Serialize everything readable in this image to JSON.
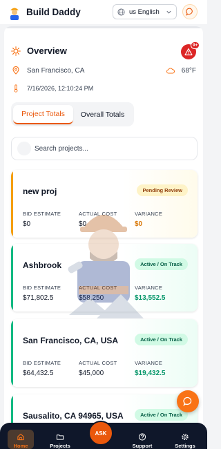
{
  "header": {
    "app_title": "Build Daddy",
    "language": "us English",
    "icons": {
      "logo": "builder-logo-icon",
      "globe": "globe-icon",
      "chevron": "chevron-down-icon",
      "chat": "chat-bubble-icon"
    }
  },
  "overview": {
    "title": "Overview",
    "alert_count": "9+",
    "location": "San Francisco, CA",
    "temperature": "68°F",
    "datetime": "7/16/2026, 12:10:24 PM"
  },
  "tabs": [
    {
      "label": "Project Totals",
      "active": true
    },
    {
      "label": "Overall Totals",
      "active": false
    }
  ],
  "search": {
    "placeholder": "Search projects..."
  },
  "labels": {
    "bid": "BID ESTIMATE",
    "actual": "ACTUAL COST",
    "variance": "VARIANCE"
  },
  "projects": [
    {
      "name": "new proj",
      "status": "Pending Review",
      "bid": "$0",
      "actual": "$0",
      "variance": "$0",
      "accent": "#f59e0b",
      "status_bg": "#fef3c7",
      "status_color": "#92400e",
      "variance_color": "#d97706"
    },
    {
      "name": "Ashbrook",
      "status": "Active / On Track",
      "bid": "$71,802.5",
      "actual": "$58,250",
      "variance": "$13,552.5",
      "accent": "#10b981",
      "status_bg": "#d1fae5",
      "status_color": "#065f46",
      "variance_color": "#059669"
    },
    {
      "name": "San Francisco, CA, USA",
      "status": "Active / On Track",
      "bid": "$64,432.5",
      "actual": "$45,000",
      "variance": "$19,432.5",
      "accent": "#10b981",
      "status_bg": "#d1fae5",
      "status_color": "#065f46",
      "variance_color": "#059669"
    },
    {
      "name": "Sausalito, CA 94965, USA",
      "status": "Active / On Track",
      "bid": "",
      "actual": "",
      "variance": "",
      "accent": "#10b981",
      "status_bg": "#d1fae5",
      "status_color": "#065f46",
      "variance_color": "#059669"
    }
  ],
  "nav": [
    {
      "label": "Home",
      "icon": "home-icon",
      "active": true
    },
    {
      "label": "Projects",
      "icon": "folder-icon",
      "active": false
    },
    {
      "label": "Support",
      "icon": "help-circle-icon",
      "active": false
    },
    {
      "label": "Settings",
      "icon": "gear-icon",
      "active": false
    }
  ],
  "ask_label": "ASK",
  "colors": {
    "accent": "#ea580c",
    "nav_bg": "#0f172a",
    "alert": "#dc2626"
  }
}
